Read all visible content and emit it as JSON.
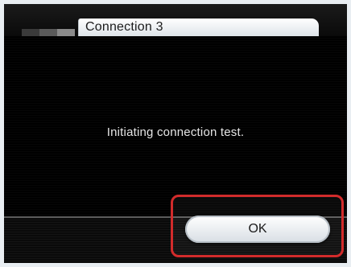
{
  "window": {
    "title": "Connection 3"
  },
  "header": {
    "block_colors": [
      "#3a3a3a",
      "#5a5a5a",
      "#8a8a8a"
    ]
  },
  "main": {
    "message": "Initiating connection test."
  },
  "footer": {
    "ok_label": "OK"
  },
  "colors": {
    "highlight": "#d22b2b",
    "background": "#000000",
    "tab": "#ffffff"
  }
}
